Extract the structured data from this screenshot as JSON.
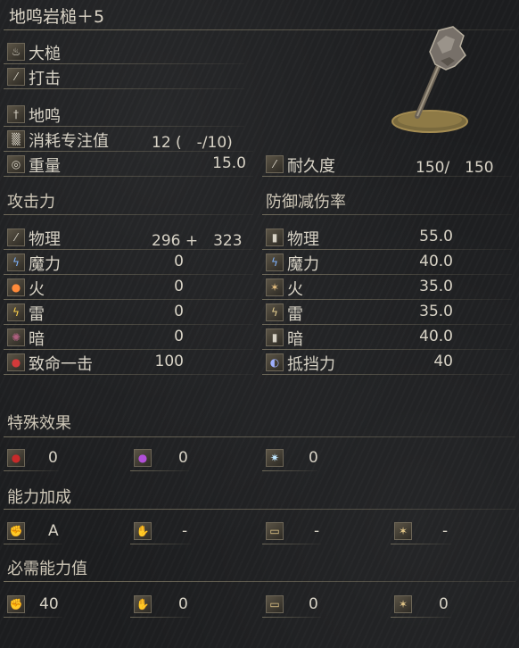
{
  "title": "地鸣岩槌＋5",
  "weapon_info": {
    "weapon_type": "大槌",
    "attack_type": "打击",
    "skill": "地鸣",
    "fp_cost_label": "消耗专注值",
    "fp_cost_value": "12 (　-/10)",
    "weight_label": "重量",
    "weight_value": "15.0",
    "durability_label": "耐久度",
    "durability_value": "150/　150"
  },
  "attack": {
    "header": "攻击力",
    "rows": [
      {
        "label": "物理",
        "value": "296 +　323",
        "icon": "physical-attack-icon"
      },
      {
        "label": "魔力",
        "value": "0",
        "icon": "magic-attack-icon"
      },
      {
        "label": "火",
        "value": "0",
        "icon": "fire-attack-icon"
      },
      {
        "label": "雷",
        "value": "0",
        "icon": "lightning-attack-icon"
      },
      {
        "label": "暗",
        "value": "0",
        "icon": "dark-attack-icon"
      },
      {
        "label": "致命一击",
        "value": "100",
        "icon": "critical-icon"
      }
    ]
  },
  "defense": {
    "header": "防御减伤率",
    "rows": [
      {
        "label": "物理",
        "value": "55.0",
        "icon": "physical-defense-icon"
      },
      {
        "label": "魔力",
        "value": "40.0",
        "icon": "magic-defense-icon"
      },
      {
        "label": "火",
        "value": "35.0",
        "icon": "fire-defense-icon"
      },
      {
        "label": "雷",
        "value": "35.0",
        "icon": "lightning-defense-icon"
      },
      {
        "label": "暗",
        "value": "40.0",
        "icon": "dark-defense-icon"
      },
      {
        "label": "抵挡力",
        "value": "40",
        "icon": "stability-icon"
      }
    ]
  },
  "special_effects": {
    "header": "特殊效果",
    "items": [
      {
        "value": "0",
        "icon": "bleed-icon"
      },
      {
        "value": "0",
        "icon": "poison-icon"
      },
      {
        "value": "0",
        "icon": "frost-icon"
      }
    ]
  },
  "scaling": {
    "header": "能力加成",
    "items": [
      {
        "value": "A",
        "icon": "strength-icon"
      },
      {
        "value": "-",
        "icon": "dexterity-icon"
      },
      {
        "value": "-",
        "icon": "intelligence-icon"
      },
      {
        "value": "-",
        "icon": "faith-icon"
      }
    ]
  },
  "requirements": {
    "header": "必需能力值",
    "items": [
      {
        "value": "40",
        "icon": "strength-icon"
      },
      {
        "value": "0",
        "icon": "dexterity-icon"
      },
      {
        "value": "0",
        "icon": "intelligence-icon"
      },
      {
        "value": "0",
        "icon": "faith-icon"
      }
    ]
  },
  "colors": {
    "background": "#1c1d1f",
    "text": "#d8d3c6",
    "divider": "#aaa082"
  }
}
